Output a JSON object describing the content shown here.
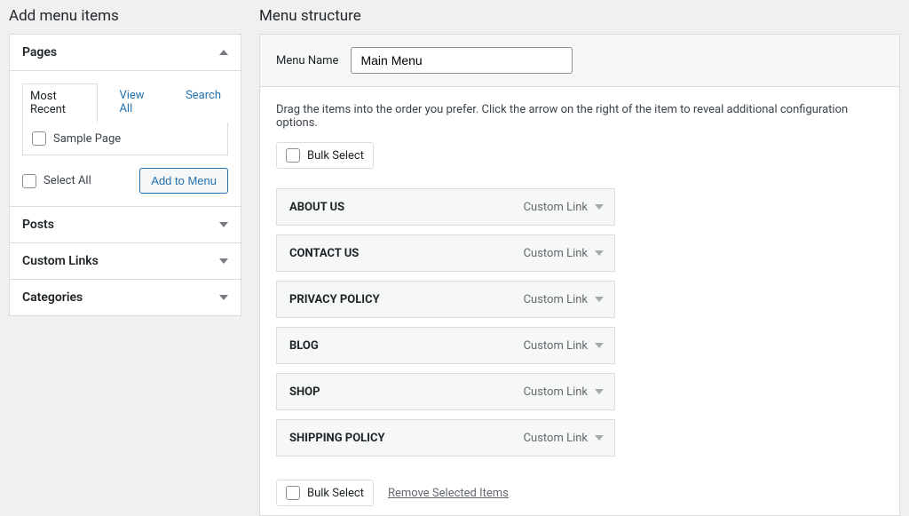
{
  "leftPanel": {
    "heading": "Add menu items",
    "sections": {
      "pages": {
        "title": "Pages",
        "tabs": {
          "recent": "Most Recent",
          "viewAll": "View All",
          "search": "Search"
        },
        "items": [
          {
            "label": "Sample Page"
          }
        ],
        "selectAll": "Select All",
        "addBtn": "Add to Menu"
      },
      "posts": {
        "title": "Posts"
      },
      "customLinks": {
        "title": "Custom Links"
      },
      "categories": {
        "title": "Categories"
      }
    }
  },
  "rightPanel": {
    "heading": "Menu structure",
    "menuNameLabel": "Menu Name",
    "menuNameValue": "Main Menu",
    "instructions": "Drag the items into the order you prefer. Click the arrow on the right of the item to reveal additional configuration options.",
    "bulkSelect": "Bulk Select",
    "removeSelected": "Remove Selected Items",
    "items": [
      {
        "title": "ABOUT US",
        "type": "Custom Link"
      },
      {
        "title": "CONTACT US",
        "type": "Custom Link"
      },
      {
        "title": "PRIVACY POLICY",
        "type": "Custom Link"
      },
      {
        "title": "BLOG",
        "type": "Custom Link"
      },
      {
        "title": "SHOP",
        "type": "Custom Link"
      },
      {
        "title": "SHIPPING POLICY",
        "type": "Custom Link"
      }
    ]
  }
}
